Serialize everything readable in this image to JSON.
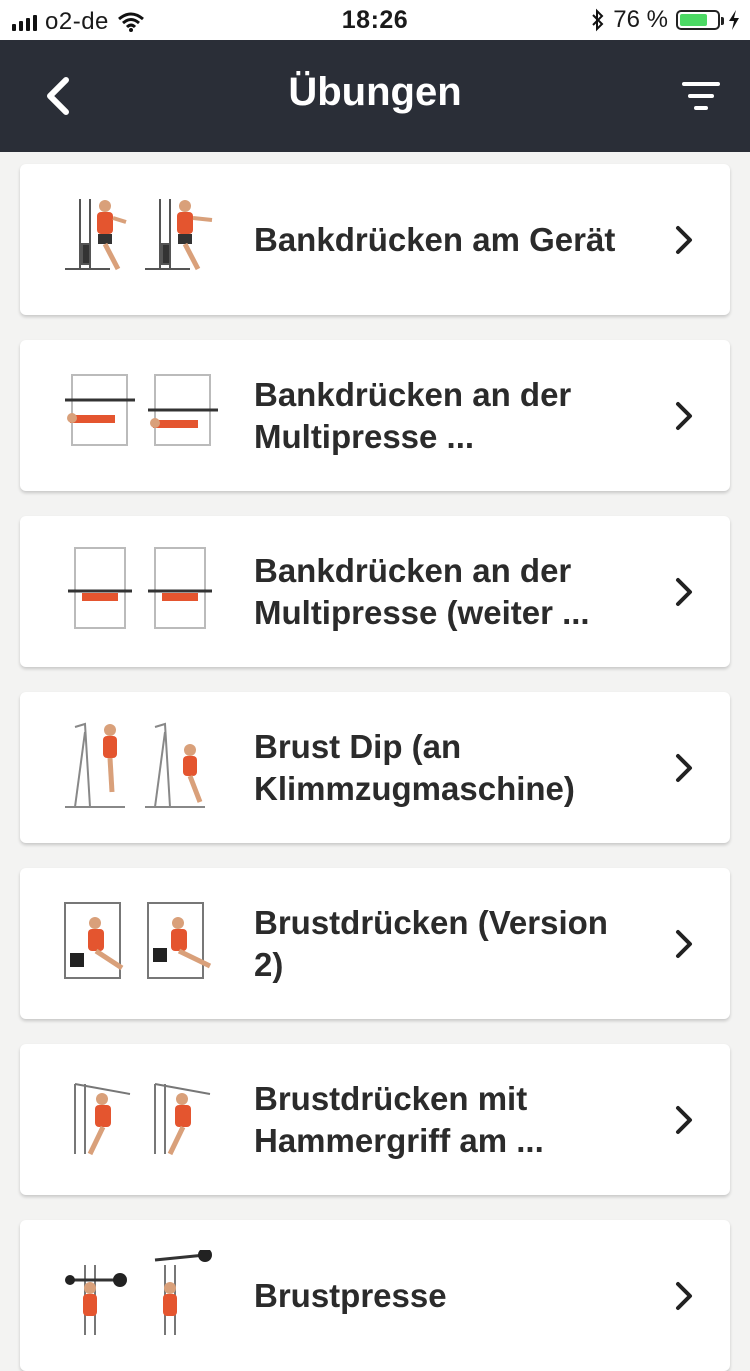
{
  "status": {
    "carrier": "o2-de",
    "time": "18:26",
    "battery": "76 %",
    "battery_level": 0.76
  },
  "header": {
    "title": "Übungen",
    "back_icon": "chevron-left-icon",
    "filter_icon": "filter-icon"
  },
  "exercises": [
    {
      "title": "Bankdrücken am Gerät"
    },
    {
      "title": "Bankdrücken an der Multipresse ..."
    },
    {
      "title": "Bankdrücken an der Multipresse (weiter ..."
    },
    {
      "title": "Brust Dip (an Klimmzugmaschine)"
    },
    {
      "title": "Brustdrücken (Version 2)"
    },
    {
      "title": "Brustdrücken mit Hammergriff am ..."
    },
    {
      "title": "Brustpresse"
    }
  ],
  "colors": {
    "header_bg": "#2a2e37",
    "page_bg": "#f3f3f2",
    "muscle_highlight": "#e4552f",
    "battery": "#4cd964"
  }
}
